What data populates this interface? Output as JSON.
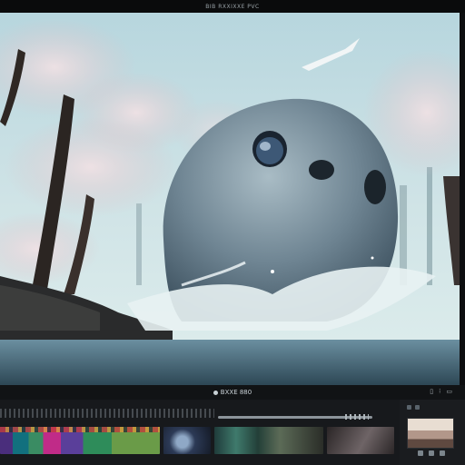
{
  "app": {
    "title": "BIB RXXIXXE PVC"
  },
  "transport": {
    "timecode": "BXXE 880",
    "right_icon_1": "▯",
    "right_icon_2": "⁝",
    "right_icon_3": "▭"
  },
  "icons": {
    "record": "record-icon",
    "viewer_corner": "fullscreen-icon",
    "panel_menu": "menu-icon",
    "settings": "settings-icon"
  },
  "colors": {
    "background": "#0d0e10",
    "timeline": "#17191c",
    "accent": "#c02b88"
  },
  "timeline": {
    "clips": [
      {
        "name": "clip-color-bars"
      },
      {
        "name": "clip-space"
      },
      {
        "name": "clip-forest"
      },
      {
        "name": "clip-dark"
      }
    ]
  }
}
